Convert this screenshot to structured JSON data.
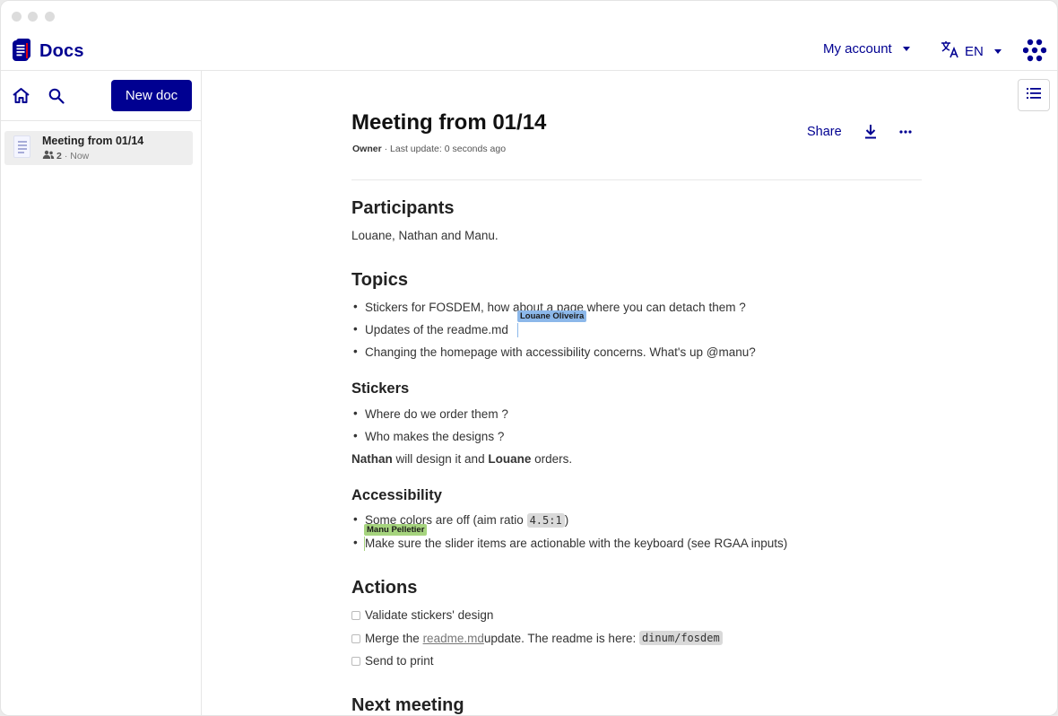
{
  "app": {
    "name": "Docs",
    "brand_color": "#000091"
  },
  "header": {
    "account_label": "My account",
    "language_label": "EN"
  },
  "sidebar": {
    "new_doc_label": "New doc",
    "docs": [
      {
        "title": "Meeting from 01/14",
        "shares": "2",
        "updated": "· Now"
      }
    ]
  },
  "document": {
    "title": "Meeting from 01/14",
    "meta_role": "Owner",
    "meta_update": " · Last update: 0 seconds ago",
    "share_label": "Share",
    "blocks": {
      "participants_heading": "Participants",
      "participants_text": "Louane, Nathan and Manu.",
      "topics_heading": "Topics",
      "topic_1": "Stickers for FOSDEM, how about a page where you can detach them ?",
      "topic_2": "Updates of the readme.md",
      "topic_3": "Changing the homepage with accessibility concerns. What's up @manu?",
      "stickers_heading": "Stickers",
      "sticker_1": "Where do we order them ?",
      "sticker_2": "Who makes the designs ?",
      "stickers_p_1": "Nathan",
      "stickers_p_2": " will design it and ",
      "stickers_p_3": "Louane",
      "stickers_p_4": " orders.",
      "access_heading": "Accessibility",
      "access_1_pre": "Some colors are off (aim ratio ",
      "access_1_code": "4.5:1",
      "access_1_post": ")",
      "access_2": "Make sure the slider items are actionable with the keyboard (see RGAA inputs)",
      "actions_heading": "Actions",
      "action_1": "Validate stickers' design",
      "action_2_pre": "Merge the ",
      "action_2_link": "readme.md",
      "action_2_mid": " update. The readme is here: ",
      "action_2_code": "dinum/fosdem",
      "action_3": "Send to print",
      "next_heading": "Next meeting"
    }
  },
  "collaborators": [
    {
      "name": "Louane Oliveira",
      "color": "#8cb8ea"
    },
    {
      "name": "Manu Pelletier",
      "color": "#a6d47e"
    }
  ]
}
